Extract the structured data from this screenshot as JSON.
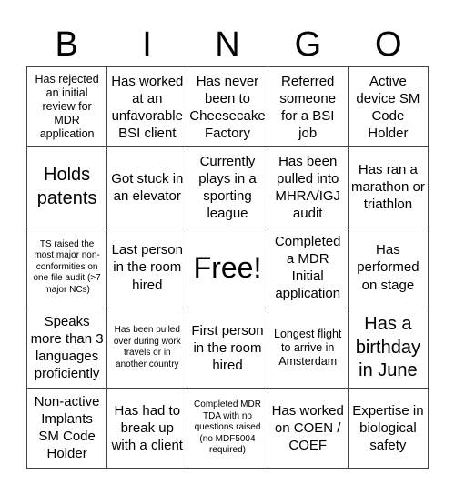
{
  "header": {
    "letters": [
      "B",
      "I",
      "N",
      "G",
      "O"
    ]
  },
  "cells": [
    {
      "text": "Has rejected an initial review for MDR application",
      "size": "sm"
    },
    {
      "text": "Has worked at an unfavorable BSI client",
      "size": "md"
    },
    {
      "text": "Has never been to Cheesecake Factory",
      "size": "md"
    },
    {
      "text": "Referred someone for a BSI job",
      "size": "md"
    },
    {
      "text": "Active device SM Code Holder",
      "size": "md"
    },
    {
      "text": "Holds patents",
      "size": "lg"
    },
    {
      "text": "Got stuck in an elevator",
      "size": "md"
    },
    {
      "text": "Currently plays in a sporting league",
      "size": "md"
    },
    {
      "text": "Has been pulled into MHRA/IGJ audit",
      "size": "md"
    },
    {
      "text": "Has ran a marathon or triathlon",
      "size": "md"
    },
    {
      "text": "TS raised the most major non-conformities on one file audit (>7 major NCs)",
      "size": "xs"
    },
    {
      "text": "Last person in the room hired",
      "size": "md"
    },
    {
      "text": "Free!",
      "size": "xl"
    },
    {
      "text": "Completed a MDR Initial application",
      "size": "md"
    },
    {
      "text": "Has performed on stage",
      "size": "md"
    },
    {
      "text": "Speaks more than 3 languages proficiently",
      "size": "md"
    },
    {
      "text": "Has been pulled over during work travels or in another country",
      "size": "xs"
    },
    {
      "text": "First person in the room hired",
      "size": "md"
    },
    {
      "text": "Longest flight to arrive in Amsterdam",
      "size": "sm"
    },
    {
      "text": "Has a birthday in June",
      "size": "lg"
    },
    {
      "text": "Non-active Implants SM Code Holder",
      "size": "md"
    },
    {
      "text": "Has had to break up with a client",
      "size": "md"
    },
    {
      "text": "Completed MDR TDA with no questions raised (no MDF5004 required)",
      "size": "xs"
    },
    {
      "text": "Has worked on COEN / COEF",
      "size": "md"
    },
    {
      "text": "Expertise in biological safety",
      "size": "md"
    }
  ]
}
